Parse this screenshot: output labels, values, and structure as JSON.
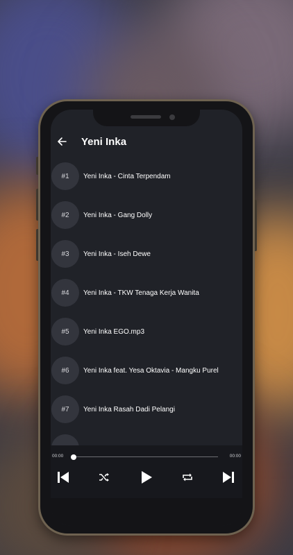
{
  "header": {
    "title": "Yeni Inka",
    "back_icon": "arrow-left-icon"
  },
  "tracks": [
    {
      "number": "#1",
      "title": "Yeni Inka - Cinta Terpendam"
    },
    {
      "number": "#2",
      "title": "Yeni Inka - Gang Dolly"
    },
    {
      "number": "#3",
      "title": "Yeni Inka - Iseh Dewe"
    },
    {
      "number": "#4",
      "title": "Yeni Inka - TKW Tenaga Kerja Wanita"
    },
    {
      "number": "#5",
      "title": "Yeni Inka EGO.mp3"
    },
    {
      "number": "#6",
      "title": "Yeni Inka feat. Yesa Oktavia - Mangku Purel"
    },
    {
      "number": "#7",
      "title": "Yeni Inka Rasah Dadi Pelangi"
    },
    {
      "number": "",
      "title": ""
    }
  ],
  "player": {
    "current_time": "00:00",
    "total_time": "00:00",
    "progress": 0,
    "controls": [
      "skip-previous-icon",
      "shuffle-icon",
      "play-icon",
      "repeat-icon",
      "skip-next-icon"
    ]
  },
  "colors": {
    "screen_bg": "#202228",
    "player_bg": "#17181d",
    "track_badge_bg": "#33353d",
    "text": "#ffffff",
    "phone_frame": "#6e6250"
  }
}
